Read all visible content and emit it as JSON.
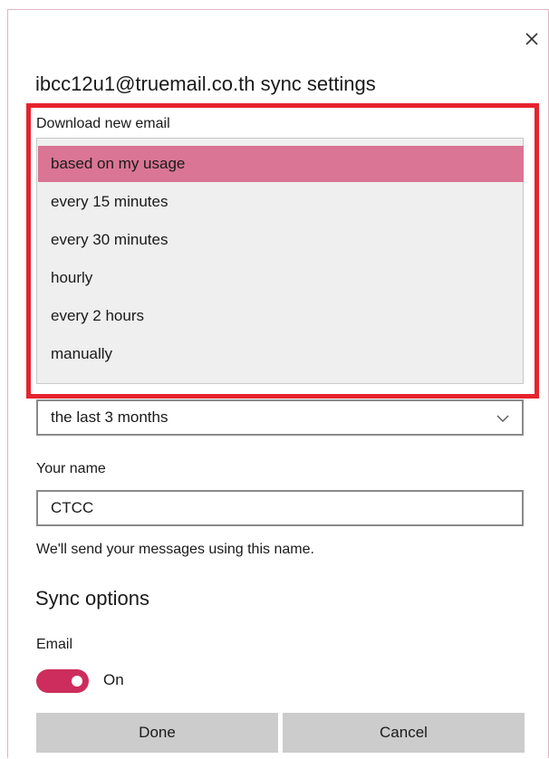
{
  "dialog": {
    "title": "ibcc12u1@truemail.co.th sync settings",
    "close_icon": "close-icon"
  },
  "download": {
    "label": "Download new email",
    "options": [
      "based on my usage",
      "every 15 minutes",
      "every 30 minutes",
      "hourly",
      "every 2 hours",
      "manually"
    ],
    "selected_index": 0
  },
  "download_range": {
    "value": "the last 3 months",
    "icon": "chevron-down-icon"
  },
  "your_name": {
    "label": "Your name",
    "value": "CTCC",
    "hint": "We'll send your messages using this name."
  },
  "sync_options": {
    "heading": "Sync options",
    "email_label": "Email",
    "email_state": "On",
    "email_on": true
  },
  "buttons": {
    "done": "Done",
    "cancel": "Cancel"
  },
  "colors": {
    "highlight_border": "#e5232e",
    "selected_option": "#da7595",
    "toggle_on": "#cc2d5c",
    "button_bg": "#cccccc"
  }
}
